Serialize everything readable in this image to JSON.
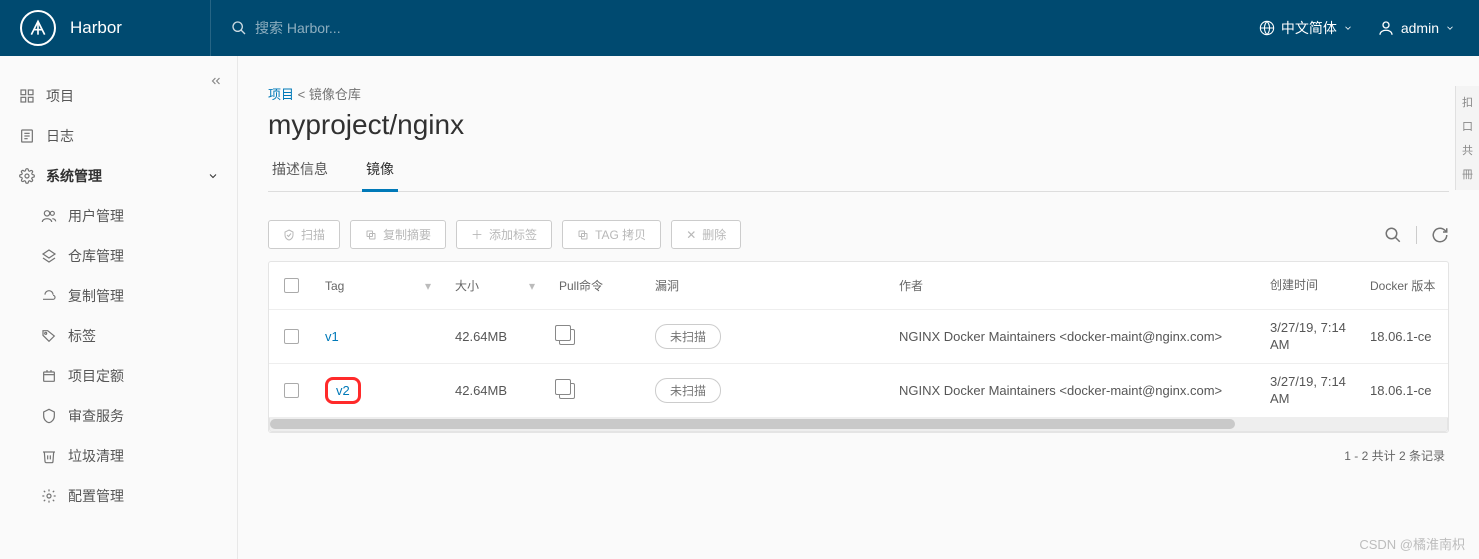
{
  "header": {
    "brand": "Harbor",
    "search_placeholder": "搜索 Harbor...",
    "language": "中文简体",
    "user": "admin"
  },
  "sidebar": {
    "items": [
      {
        "label": "项目"
      },
      {
        "label": "日志"
      },
      {
        "label": "系统管理"
      },
      {
        "label": "用户管理"
      },
      {
        "label": "仓库管理"
      },
      {
        "label": "复制管理"
      },
      {
        "label": "标签"
      },
      {
        "label": "项目定额"
      },
      {
        "label": "审查服务"
      },
      {
        "label": "垃圾清理"
      },
      {
        "label": "配置管理"
      }
    ]
  },
  "breadcrumb": {
    "root": "项目",
    "sep": "<",
    "current": "镜像仓库"
  },
  "page": {
    "title": "myproject/nginx"
  },
  "tabs": {
    "info": "描述信息",
    "images": "镜像"
  },
  "toolbar": {
    "scan": "扫描",
    "copy_digest": "复制摘要",
    "add_tag": "添加标签",
    "tag_copy": "TAG 拷贝",
    "delete": "删除"
  },
  "columns": {
    "tag": "Tag",
    "size": "大小",
    "pull": "Pull命令",
    "vuln": "漏洞",
    "author": "作者",
    "created": "创建时间",
    "docker": "Docker 版本"
  },
  "rows": [
    {
      "tag": "v1",
      "size": "42.64MB",
      "vuln": "未扫描",
      "author": "NGINX Docker Maintainers <docker-maint@nginx.com>",
      "created": "3/27/19, 7:14 AM",
      "docker": "18.06.1-ce"
    },
    {
      "tag": "v2",
      "size": "42.64MB",
      "vuln": "未扫描",
      "author": "NGINX Docker Maintainers <docker-maint@nginx.com>",
      "created": "3/27/19, 7:14 AM",
      "docker": "18.06.1-ce"
    }
  ],
  "footer": {
    "pagination": "1 - 2 共计 2 条记录"
  },
  "watermark": "CSDN @橘淮南枳"
}
